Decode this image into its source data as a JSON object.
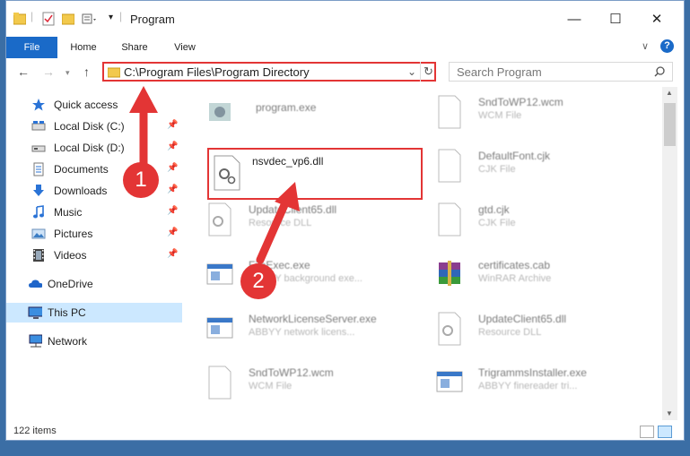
{
  "window": {
    "title": "Program",
    "minimize": "—",
    "maximize": "☐",
    "close": "✕"
  },
  "ribbon": {
    "tabs": [
      "File",
      "Home",
      "Share",
      "View"
    ],
    "help": "?"
  },
  "address": {
    "path": "C:\\Program Files\\Program Directory",
    "search_placeholder": "Search Program"
  },
  "nav": {
    "items": [
      {
        "label": "Quick access",
        "icon": "star-icon",
        "pinned": false
      },
      {
        "label": "Local Disk (C:)",
        "icon": "drive-icon",
        "pinned": true
      },
      {
        "label": "Local Disk (D:)",
        "icon": "drive-icon",
        "pinned": true
      },
      {
        "label": "Documents",
        "icon": "documents-icon",
        "pinned": true
      },
      {
        "label": "Downloads",
        "icon": "download-icon",
        "pinned": true
      },
      {
        "label": "Music",
        "icon": "music-icon",
        "pinned": true
      },
      {
        "label": "Pictures",
        "icon": "pictures-icon",
        "pinned": true
      },
      {
        "label": "Videos",
        "icon": "videos-icon",
        "pinned": true
      },
      {
        "label": "OneDrive",
        "icon": "cloud-icon",
        "pinned": false
      },
      {
        "label": "This PC",
        "icon": "computer-icon",
        "pinned": false
      },
      {
        "label": "Network",
        "icon": "network-icon",
        "pinned": false
      }
    ]
  },
  "files": [
    {
      "name": "program.exe",
      "desc": "",
      "icon": "exe-icon"
    },
    {
      "name": "SndToWP12.wcm",
      "desc": "WCM File",
      "icon": "file-icon"
    },
    {
      "name": "nsvdec_vp6.dll",
      "desc": "",
      "icon": "dll-icon"
    },
    {
      "name": "DefaultFont.cjk",
      "desc": "CJK File",
      "icon": "file-icon"
    },
    {
      "name": "UpdateClient65.dll",
      "desc": "Resource DLL",
      "icon": "dll-icon"
    },
    {
      "name": "gtd.cjk",
      "desc": "CJK File",
      "icon": "file-icon"
    },
    {
      "name": "FileExec.exe",
      "desc": "ABBYY background exe...",
      "icon": "exe-icon"
    },
    {
      "name": "certificates.cab",
      "desc": "WinRAR Archive",
      "icon": "archive-icon"
    },
    {
      "name": "NetworkLicenseServer.exe",
      "desc": "ABBYY network licens...",
      "icon": "exe-icon"
    },
    {
      "name": "UpdateClient65.dll",
      "desc": "Resource DLL",
      "icon": "dll-icon"
    },
    {
      "name": "SndToWP12.wcm",
      "desc": "WCM File",
      "icon": "file-icon"
    },
    {
      "name": "TrigrammsInstaller.exe",
      "desc": "ABBYY finereader tri...",
      "icon": "exe-icon"
    }
  ],
  "status": {
    "count": "122 items"
  },
  "annotations": {
    "step1": "1",
    "step2": "2"
  },
  "colors": {
    "accent": "#1a6ac8",
    "highlight": "#e33535",
    "selection": "#cce8ff"
  }
}
